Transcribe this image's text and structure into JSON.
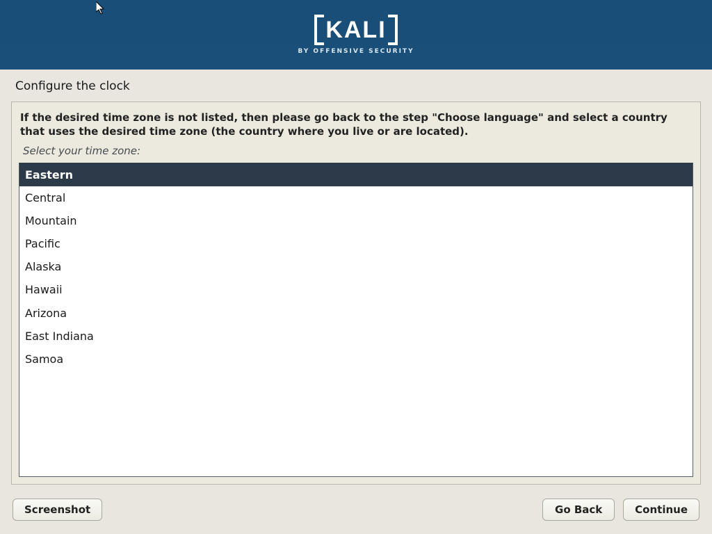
{
  "header": {
    "brand": "KALI",
    "tagline": "BY OFFENSIVE SECURITY"
  },
  "title": "Configure the clock",
  "instruction": "If the desired time zone is not listed, then please go back to the step \"Choose language\" and select a country that uses the desired time zone (the country where you live or are located).",
  "prompt": "Select your time zone:",
  "timezones": {
    "selected_index": 0,
    "items": [
      "Eastern",
      "Central",
      "Mountain",
      "Pacific",
      "Alaska",
      "Hawaii",
      "Arizona",
      "East Indiana",
      "Samoa"
    ]
  },
  "buttons": {
    "screenshot": "Screenshot",
    "go_back": "Go Back",
    "continue": "Continue"
  }
}
